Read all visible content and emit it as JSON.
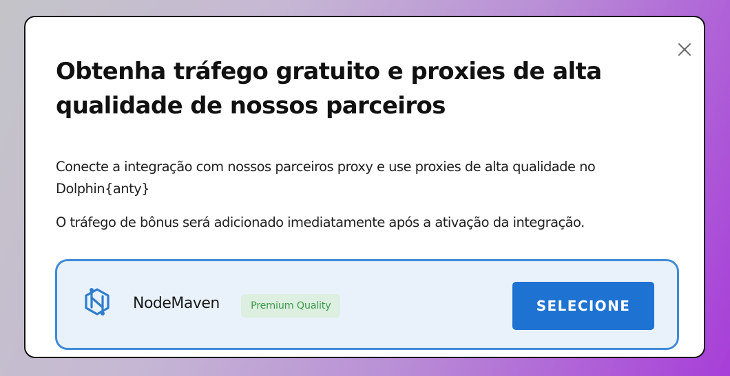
{
  "dialog": {
    "title": "Obtenha tráfego gratuito e proxies de alta qualidade de nossos parceiros",
    "description": "Conecte a integração com nossos parceiros proxy e use proxies de alta qualidade no Dolphin{anty}",
    "bonus_note": "O tráfego de bônus será adicionado imediatamente após a ativação da integração.",
    "close_icon": "close-x-icon"
  },
  "partner": {
    "name": "NodeMaven",
    "badge": "Premium Quality",
    "button_label": "SELECIONE",
    "logo_icon": "nodemaven-logo-icon"
  },
  "colors": {
    "primary": "#1e73d2",
    "card_border": "#3f8ad8",
    "card_background": "#e9f2fb",
    "badge_background": "#dcefe0",
    "badge_text": "#3f9a4f"
  }
}
